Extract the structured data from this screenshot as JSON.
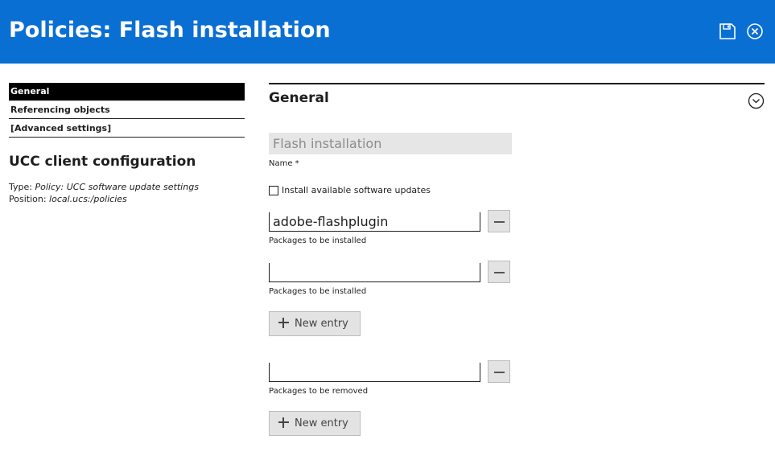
{
  "header": {
    "title": "Policies: Flash installation",
    "save_icon": "save-icon",
    "close_icon": "close-circle-icon",
    "background": "#0a6fd3"
  },
  "sidebar": {
    "items": [
      {
        "label": "General",
        "active": true
      },
      {
        "label": "Referencing objects",
        "active": false
      },
      {
        "label": "[Advanced settings]",
        "active": false
      }
    ],
    "object_title": "UCC client configuration",
    "type_label": "Type:",
    "type_value": "Policy: UCC software update settings",
    "position_label": "Position:",
    "position_value": "local.ucs:/policies"
  },
  "main": {
    "section_title": "General",
    "collapse_icon": "chevron-down-circle-icon",
    "name_field": {
      "value": "Flash installation",
      "label": "Name *"
    },
    "checkbox": {
      "label": "Install available software updates",
      "checked": false
    },
    "install_entries": [
      {
        "value": "adobe-flashplugin",
        "label": "Packages to be installed"
      },
      {
        "value": "",
        "label": "Packages to be installed"
      }
    ],
    "install_new_entry_label": "New entry",
    "remove_entries": [
      {
        "value": "",
        "label": "Packages to be removed"
      }
    ],
    "remove_new_entry_label": "New entry"
  }
}
